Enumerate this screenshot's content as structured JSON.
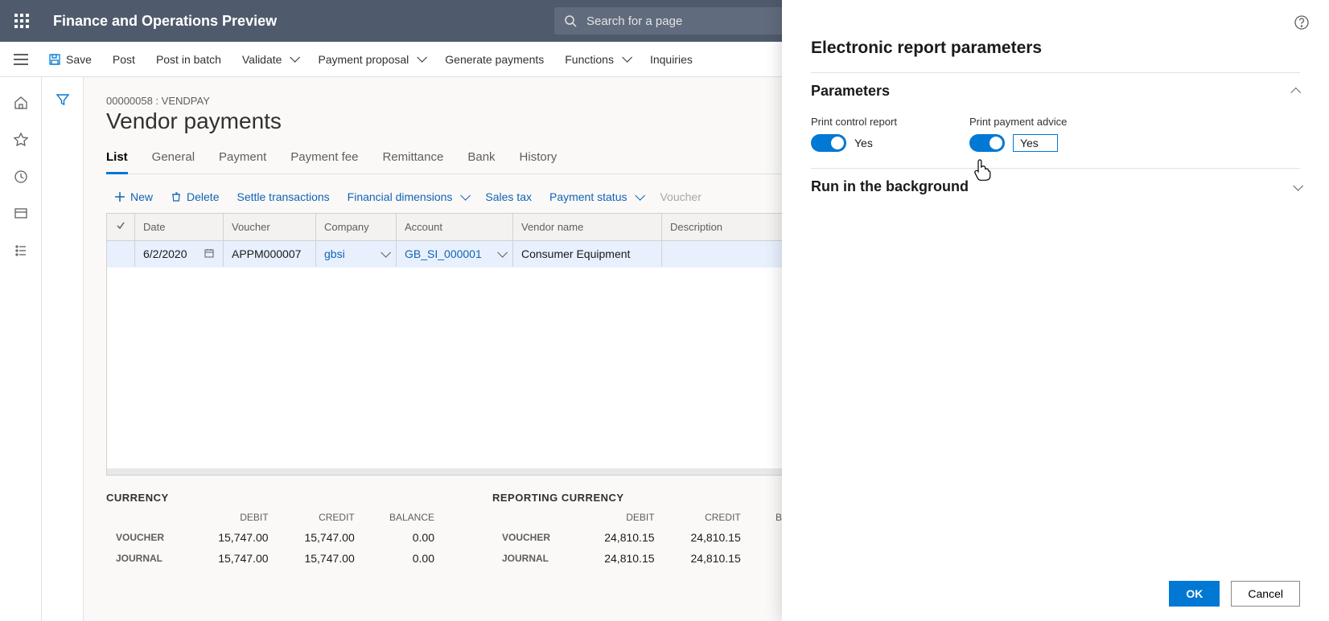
{
  "app_title": "Finance and Operations Preview",
  "search_placeholder": "Search for a page",
  "commands": {
    "save": "Save",
    "post": "Post",
    "post_batch": "Post in batch",
    "validate": "Validate",
    "payment_proposal": "Payment proposal",
    "generate_payments": "Generate payments",
    "functions": "Functions",
    "inquiries": "Inquiries"
  },
  "breadcrumb": "00000058 : VENDPAY",
  "page_title": "Vendor payments",
  "tabs": [
    "List",
    "General",
    "Payment",
    "Payment fee",
    "Remittance",
    "Bank",
    "History"
  ],
  "active_tab": "List",
  "grid_toolbar": {
    "new": "New",
    "delete": "Delete",
    "settle": "Settle transactions",
    "fin_dim": "Financial dimensions",
    "sales_tax": "Sales tax",
    "pay_status": "Payment status",
    "voucher": "Voucher"
  },
  "grid": {
    "headers": [
      "Date",
      "Voucher",
      "Company",
      "Account",
      "Vendor name",
      "Description"
    ],
    "row": {
      "date": "6/2/2020",
      "voucher": "APPM000007",
      "company": "gbsi",
      "account": "GB_SI_000001",
      "vendor_name": "Consumer Equipment",
      "description": ""
    }
  },
  "summary": {
    "currency_title": "CURRENCY",
    "reporting_title": "REPORTING CURRENCY",
    "col_debit": "DEBIT",
    "col_credit": "CREDIT",
    "col_balance": "BALANCE",
    "row_voucher": "VOUCHER",
    "row_journal": "JOURNAL",
    "currency": {
      "voucher": {
        "debit": "15,747.00",
        "credit": "15,747.00",
        "balance": "0.00"
      },
      "journal": {
        "debit": "15,747.00",
        "credit": "15,747.00",
        "balance": "0.00"
      }
    },
    "reporting": {
      "voucher": {
        "debit": "24,810.15",
        "credit": "24,810.15",
        "balance": ""
      },
      "journal": {
        "debit": "24,810.15",
        "credit": "24,810.15",
        "balance": ""
      }
    }
  },
  "panel": {
    "title": "Electronic report parameters",
    "section_parameters": "Parameters",
    "section_background": "Run in the background",
    "print_control": {
      "label": "Print control report",
      "value": "Yes"
    },
    "print_advice": {
      "label": "Print payment advice",
      "value": "Yes"
    },
    "ok": "OK",
    "cancel": "Cancel"
  }
}
